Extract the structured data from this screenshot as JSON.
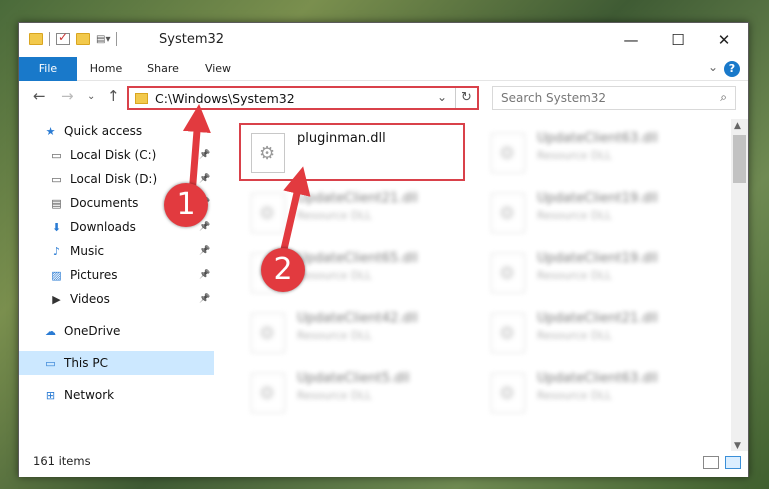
{
  "window": {
    "title": "System32",
    "controls": {
      "minimize": "—",
      "maximize": "☐",
      "close": "✕"
    }
  },
  "ribbon": {
    "tabs": [
      {
        "label": "File"
      },
      {
        "label": "Home"
      },
      {
        "label": "Share"
      },
      {
        "label": "View"
      }
    ],
    "help": "?"
  },
  "nav": {
    "address": "C:\\Windows\\System32",
    "search_placeholder": "Search System32"
  },
  "sidebar": {
    "items": [
      {
        "label": "Quick access",
        "icon": "star-icon",
        "pinned": false
      },
      {
        "label": "Local Disk (C:)",
        "icon": "drive-icon",
        "pinned": true
      },
      {
        "label": "Local Disk (D:)",
        "icon": "drive-icon",
        "pinned": true
      },
      {
        "label": "Documents",
        "icon": "documents-icon",
        "pinned": true
      },
      {
        "label": "Downloads",
        "icon": "download-icon",
        "pinned": true
      },
      {
        "label": "Music",
        "icon": "music-icon",
        "pinned": true
      },
      {
        "label": "Pictures",
        "icon": "pictures-icon",
        "pinned": true
      },
      {
        "label": "Videos",
        "icon": "videos-icon",
        "pinned": true
      },
      {
        "label": "OneDrive",
        "icon": "cloud-icon",
        "pinned": false
      },
      {
        "label": "This PC",
        "icon": "computer-icon",
        "pinned": false,
        "selected": true
      },
      {
        "label": "Network",
        "icon": "network-icon",
        "pinned": false
      }
    ]
  },
  "files": {
    "highlighted": {
      "name": "pluginman.dll"
    },
    "others": [
      {
        "name": "UpdateClient63.dll",
        "type": "Resource DLL"
      },
      {
        "name": "UpdateClient21.dll",
        "type": "Resource DLL"
      },
      {
        "name": "UpdateClient19.dll",
        "type": "Resource DLL"
      },
      {
        "name": "UpdateClient65.dll",
        "type": "Resource DLL"
      },
      {
        "name": "UpdateClient19.dll",
        "type": "Resource DLL"
      },
      {
        "name": "UpdateClient42.dll",
        "type": "Resource DLL"
      },
      {
        "name": "UpdateClient21.dll",
        "type": "Resource DLL"
      },
      {
        "name": "UpdateClient5.dll",
        "type": "Resource DLL"
      },
      {
        "name": "UpdateClient63.dll",
        "type": "Resource DLL"
      }
    ]
  },
  "status": {
    "item_count": "161 items"
  },
  "annotations": {
    "step1": "1",
    "step2": "2",
    "color": "#e23a3f"
  }
}
